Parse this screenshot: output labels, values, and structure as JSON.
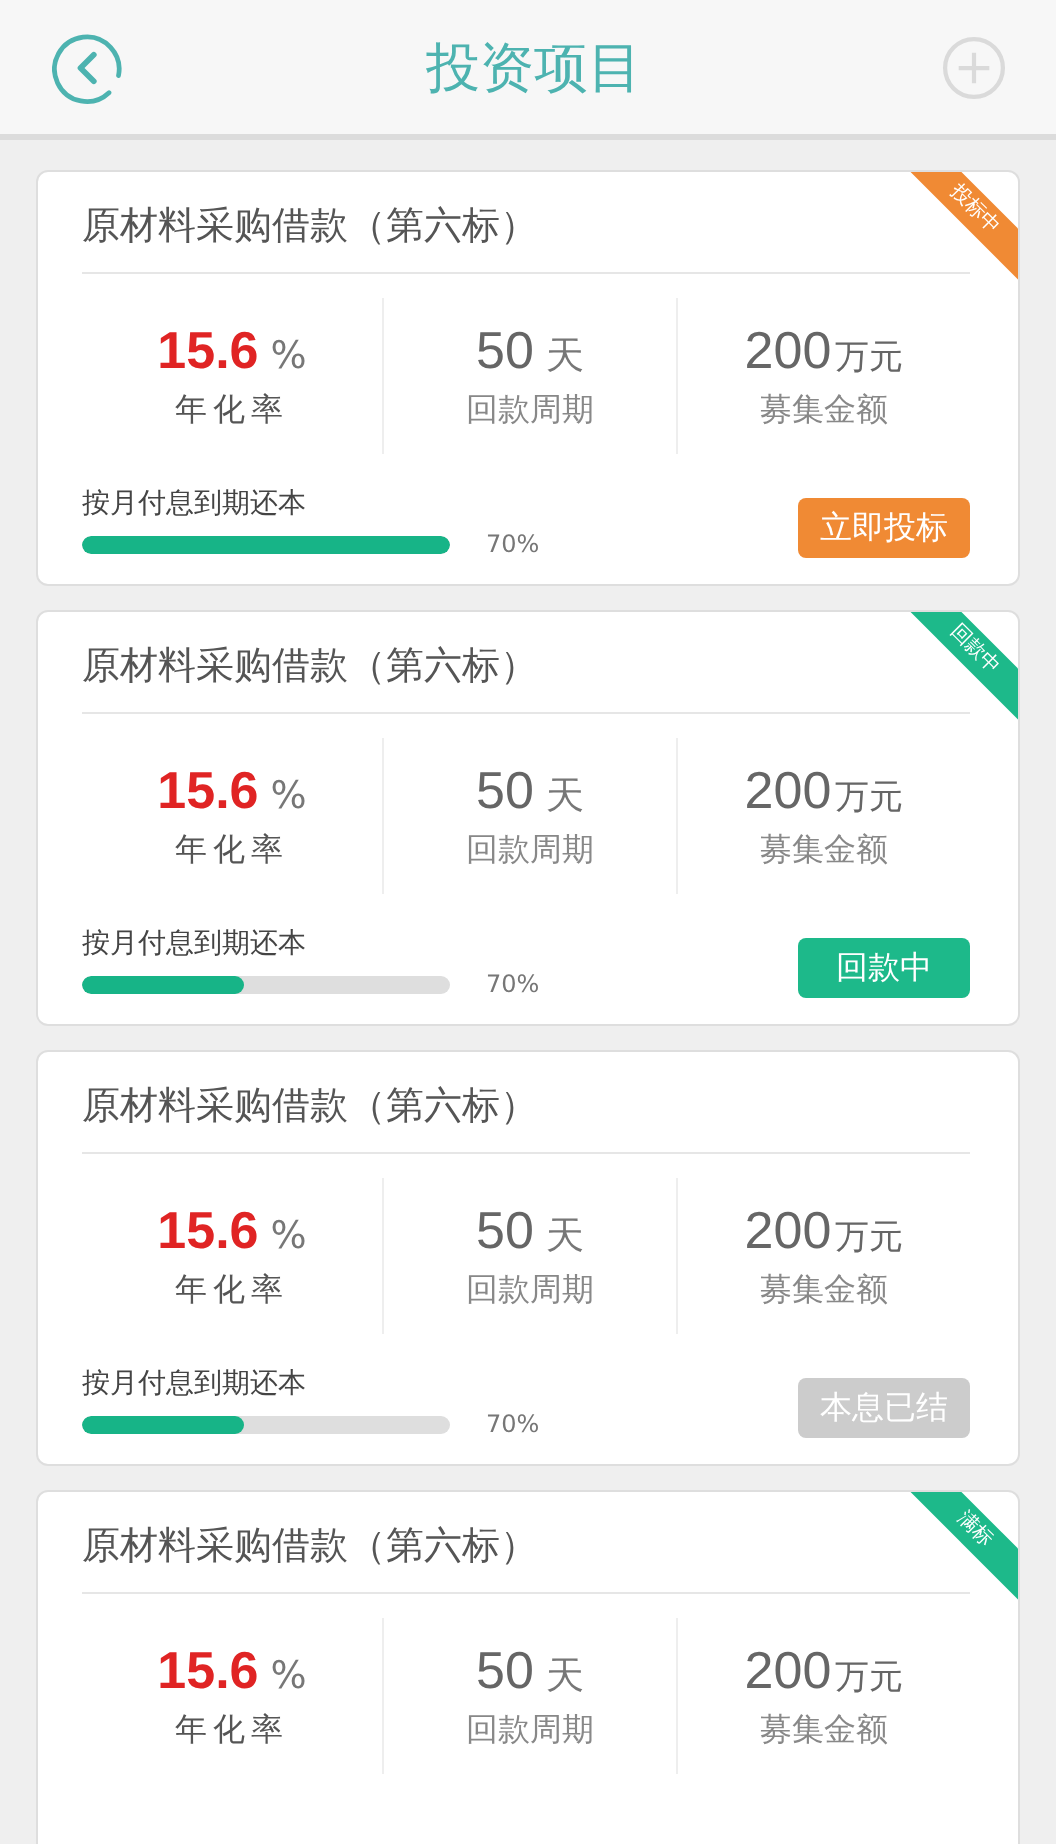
{
  "header": {
    "title": "投资项目"
  },
  "projects": [
    {
      "title": "原材料采购借款（第六标）",
      "rate": "15.6",
      "rate_unit": "%",
      "rate_label": "年化率",
      "period": "50",
      "period_unit": "天",
      "period_label": "回款周期",
      "amount": "200",
      "amount_unit": "万元",
      "amount_label": "募集金额",
      "ribbon": {
        "text": "投标中",
        "color": "#f08a34"
      },
      "repay": "按月付息到期还本",
      "level": 1.0,
      "percent": "70%",
      "button": {
        "label": "立即投标",
        "color": "#f08a34"
      }
    },
    {
      "title": "原材料采购借款（第六标）",
      "rate": "15.6",
      "rate_unit": "%",
      "rate_label": "年化率",
      "period": "50",
      "period_unit": "天",
      "period_label": "回款周期",
      "amount": "200",
      "amount_unit": "万元",
      "amount_label": "募集金额",
      "ribbon": {
        "text": "回款中",
        "color": "#1db98a"
      },
      "repay": "按月付息到期还本",
      "level": 0.44,
      "percent": "70%",
      "button": {
        "label": "回款中",
        "color": "#1db98a"
      }
    },
    {
      "title": "原材料采购借款（第六标）",
      "rate": "15.6",
      "rate_unit": "%",
      "rate_label": "年化率",
      "period": "50",
      "period_unit": "天",
      "period_label": "回款周期",
      "amount": "200",
      "amount_unit": "万元",
      "amount_label": "募集金额",
      "repay": "按月付息到期还本",
      "level": 0.44,
      "percent": "70%",
      "button": {
        "label": "本息已结",
        "color": "#cccccc"
      }
    },
    {
      "title": "原材料采购借款（第六标）",
      "rate": "15.6",
      "rate_unit": "%",
      "rate_label": "年化率",
      "period": "50",
      "period_unit": "天",
      "period_label": "回款周期",
      "amount": "200",
      "amount_unit": "万元",
      "amount_label": "募集金额",
      "ribbon": {
        "text": "满标",
        "color": "#1db98a"
      }
    }
  ]
}
